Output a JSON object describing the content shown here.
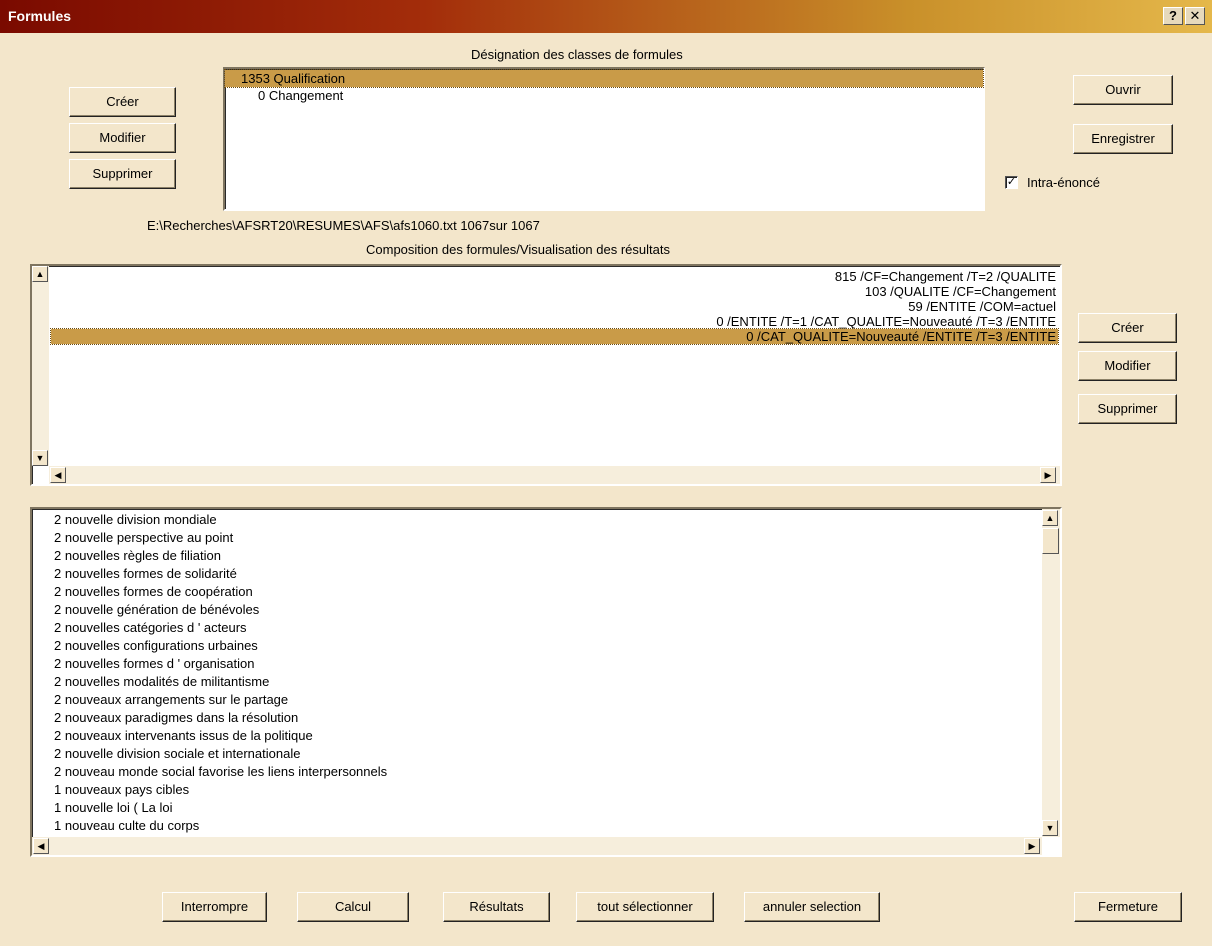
{
  "window": {
    "title": "Formules",
    "help": "?",
    "close": "✕"
  },
  "classes": {
    "heading": "Désignation des classes de formules",
    "items": [
      {
        "text": "1353  Qualification",
        "selected": true
      },
      {
        "text": "0  Changement",
        "selected": false
      }
    ],
    "create": "Créer",
    "modify": "Modifier",
    "delete": "Supprimer"
  },
  "file": {
    "open": "Ouvrir",
    "save": "Enregistrer",
    "intra_label": "Intra-énoncé",
    "intra_checked": true,
    "path": "E:\\Recherches\\AFSRT20\\RESUMES\\AFS\\afs1060.txt 1067sur 1067"
  },
  "composition": {
    "heading": "Composition des formules/Visualisation des résultats",
    "items": [
      {
        "text": "815  /CF=Changement /T=2 /QUALITE",
        "selected": false
      },
      {
        "text": "103  /QUALITE /CF=Changement",
        "selected": false
      },
      {
        "text": "59  /ENTITE /COM=actuel",
        "selected": false
      },
      {
        "text": "0  /ENTITE /T=1 /CAT_QUALITE=Nouveauté /T=3 /ENTITE",
        "selected": false
      },
      {
        "text": "0  /CAT_QUALITE=Nouveauté /ENTITE /T=3 /ENTITE",
        "selected": true
      }
    ],
    "create": "Créer",
    "modify": "Modifier",
    "delete": "Supprimer"
  },
  "results": {
    "items": [
      "2  nouvelle division mondiale",
      "2  nouvelle perspective au point",
      "2  nouvelles règles de filiation",
      "2  nouvelles formes de solidarité",
      "2  nouvelles formes de coopération",
      "2  nouvelle génération de bénévoles",
      "2  nouvelles catégories d ' acteurs",
      "2  nouvelles configurations urbaines",
      "2  nouvelles formes d ' organisation",
      "2  nouvelles modalités de militantisme",
      "2  nouveaux arrangements sur le partage",
      "2  nouveaux paradigmes dans la résolution",
      "2  nouveaux intervenants issus de la politique",
      "2  nouvelle division sociale et internationale",
      "2  nouveau monde social favorise les liens interpersonnels",
      "1  nouveaux pays cibles",
      "1  nouvelle loi ( La loi",
      "1  nouveau culte du corps"
    ]
  },
  "footer": {
    "interrupt": "Interrompre",
    "compute": "Calcul",
    "results": "Résultats",
    "select_all": "tout sélectionner",
    "cancel_selection": "annuler selection",
    "close": "Fermeture"
  }
}
